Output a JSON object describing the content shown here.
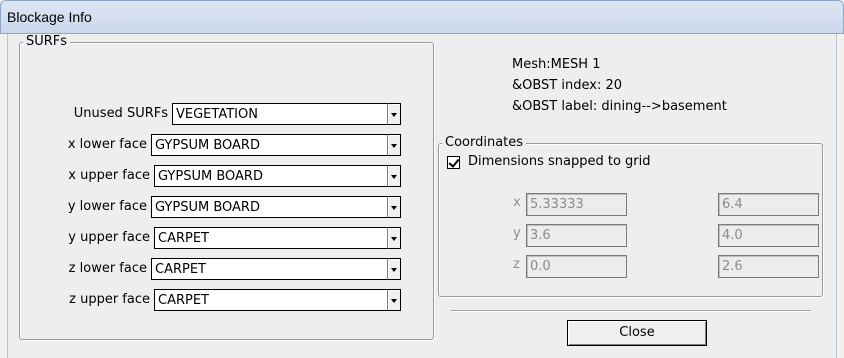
{
  "window": {
    "title": "Blockage Info"
  },
  "surfs": {
    "group_title": "SURFs",
    "rows": [
      {
        "label": "Unused SURFs",
        "value": "VEGETATION"
      },
      {
        "label": "x lower face",
        "value": "GYPSUM BOARD"
      },
      {
        "label": "x upper face",
        "value": "GYPSUM BOARD"
      },
      {
        "label": "y lower face",
        "value": "GYPSUM BOARD"
      },
      {
        "label": "y upper face",
        "value": "CARPET"
      },
      {
        "label": "z lower face",
        "value": "CARPET"
      },
      {
        "label": "z upper face",
        "value": "CARPET"
      }
    ]
  },
  "info": {
    "mesh": "Mesh:MESH  1",
    "obst_index": "&OBST index: 20",
    "obst_label": "&OBST label: dining-->basement"
  },
  "coordinates": {
    "group_title": "Coordinates",
    "snap_checked": true,
    "snap_label": "Dimensions snapped to grid",
    "x": {
      "axis": "x",
      "min": "5.33333",
      "max": "6.4"
    },
    "y": {
      "axis": "y",
      "min": "3.6",
      "max": "4.0"
    },
    "z": {
      "axis": "z",
      "min": "0.0",
      "max": "2.6"
    }
  },
  "buttons": {
    "close": "Close"
  },
  "icons": {
    "dropdown": "dropdown-arrow-icon",
    "checkbox": "checkmark-icon"
  }
}
